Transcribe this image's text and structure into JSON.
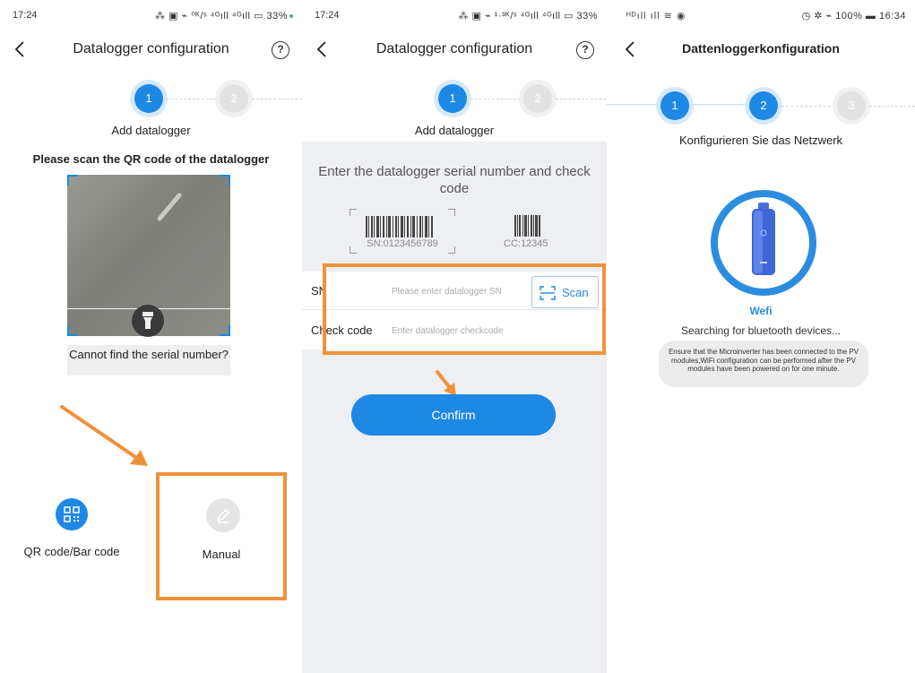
{
  "screen1": {
    "status": {
      "time": "17:24",
      "right": "⁂ ▣ ⌁ ⁰ᴷ/ˢ ⁴ᴳıll ⁴ᴳıll ▭ 33%"
    },
    "header": {
      "title": "Datalogger configuration",
      "help": "?"
    },
    "steps": {
      "step1": "1",
      "step2": "2",
      "label": "Add datalogger"
    },
    "heading": "Please scan the QR code of the datalogger",
    "cannot_find": "Cannot find the serial number?",
    "options": {
      "qr": "QR code/Bar code",
      "manual": "Manual"
    },
    "colors": {
      "accent": "#1e88e5",
      "highlight": "#f0913a"
    }
  },
  "screen2": {
    "status": {
      "time": "17:24",
      "right": "⁂ ▣ ⌁ ¹·³ᴷ/ˢ ⁴ᴳıll ⁴ᴳıll ▭ 33%"
    },
    "header": {
      "title": "Datalogger configuration",
      "help": "?"
    },
    "steps": {
      "step1": "1",
      "step2": "2",
      "label": "Add datalogger"
    },
    "instruction": "Enter the datalogger serial number and check code",
    "sample_sn": "SN:0123456789",
    "sample_cc": "CC:12345",
    "form": {
      "sn_label": "SN",
      "sn_placeholder": "Please enter datalogger SN",
      "scan_label": "Scan",
      "check_label": "Check code",
      "check_placeholder": "Enter datalogger checkcode"
    },
    "confirm_label": "Confirm"
  },
  "screen3": {
    "status": {
      "left": "ᴴᴰıll ıll ≋ ◉",
      "right": "◷ ✲ ⌁ 100% ▬ 16:34"
    },
    "header": {
      "title": "Dattenloggerkonfiguration"
    },
    "steps": {
      "step1": "1",
      "step2": "2",
      "step3": "3",
      "label": "Konfigurieren Sie das Netzwerk"
    },
    "device_name": "Wefi",
    "searching": "Searching for bluetooth devices...",
    "note": "Ensure that the Microinverter has been connected to the PV modules,WiFi configuration can be performed after the PV modules have been powered on for one minute."
  }
}
